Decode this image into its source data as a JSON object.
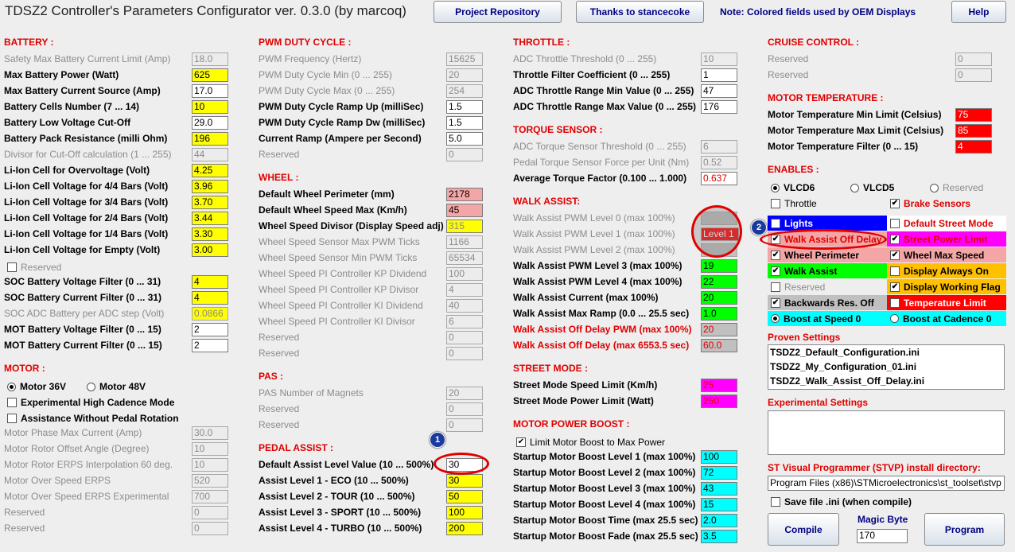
{
  "app": {
    "title": "TDSZ2 Controller's Parameters Configurator ver. 0.3.0 (by marcoq)"
  },
  "toolbar": {
    "repo": "Project Repository",
    "thanks": "Thanks to stancecoke",
    "note": "Note: Colored fields used by OEM Displays",
    "help": "Help"
  },
  "battery": {
    "title": "BATTERY :",
    "rows": [
      {
        "label": "Safety Max Battery Current Limit (Amp)",
        "value": "18.0"
      },
      {
        "label": "Max Battery Power (Watt)",
        "value": "625"
      },
      {
        "label": "Max Battery Current Source (Amp)",
        "value": "17.0"
      },
      {
        "label": "Battery Cells Number (7 ... 14)",
        "value": "10"
      },
      {
        "label": "Battery Low Voltage Cut-Off",
        "value": "29.0"
      },
      {
        "label": "Battery Pack Resistance (milli Ohm)",
        "value": "196"
      },
      {
        "label": "Divisor for Cut-Off calculation (1 ... 255)",
        "value": "44"
      },
      {
        "label": "Li-Ion Cell for Overvoltage (Volt)",
        "value": "4.25"
      },
      {
        "label": "Li-Ion Cell Voltage for 4/4 Bars (Volt)",
        "value": "3.96"
      },
      {
        "label": "Li-Ion Cell Voltage for 3/4 Bars (Volt)",
        "value": "3.70"
      },
      {
        "label": "Li-Ion Cell Voltage for 2/4 Bars (Volt)",
        "value": "3.44"
      },
      {
        "label": "Li-Ion Cell Voltage for 1/4 Bars (Volt)",
        "value": "3.30"
      },
      {
        "label": "Li-Ion Cell Voltage for Empty (Volt)",
        "value": "3.00"
      }
    ],
    "reserved": "Reserved",
    "rows2": [
      {
        "label": "SOC Battery Voltage Filter (0 ... 31)",
        "value": "4"
      },
      {
        "label": "SOC Battery Current Filter (0 ... 31)",
        "value": "4"
      },
      {
        "label": "SOC ADC Battery per ADC step (Volt)",
        "value": "0.0866"
      },
      {
        "label": "MOT Battery Voltage Filter (0 ... 15)",
        "value": "2"
      },
      {
        "label": "MOT Battery Current Filter (0 ... 15)",
        "value": "2"
      }
    ]
  },
  "motor": {
    "title": "MOTOR :",
    "v36": "Motor 36V",
    "v48": "Motor 48V",
    "high_cad": "Experimental High Cadence Mode",
    "assist_no_pedal": "Assistance Without Pedal Rotation",
    "rows": [
      {
        "label": "Motor Phase Max Current (Amp)",
        "value": "30.0"
      },
      {
        "label": "Motor Rotor Offset Angle (Degree)",
        "value": "10"
      },
      {
        "label": "Motor Rotor ERPS Interpolation 60 deg.",
        "value": "10"
      },
      {
        "label": "Motor Over Speed ERPS",
        "value": "520"
      },
      {
        "label": "Motor Over Speed ERPS Experimental",
        "value": "700"
      },
      {
        "label": "Reserved",
        "value": "0"
      },
      {
        "label": "Reserved",
        "value": "0"
      }
    ]
  },
  "pwm": {
    "title": "PWM DUTY CYCLE :",
    "rows": [
      {
        "label": "PWM Frequency (Hertz)",
        "value": "15625"
      },
      {
        "label": "PWM Duty Cycle Min (0 ... 255)",
        "value": "20"
      },
      {
        "label": "PWM Duty Cycle Max (0 ... 255)",
        "value": "254"
      },
      {
        "label": "PWM Duty Cycle Ramp Up (milliSec)",
        "value": "1.5"
      },
      {
        "label": "PWM Duty Cycle Ramp Dw (milliSec)",
        "value": "1.5"
      },
      {
        "label": "Current Ramp (Ampere per Second)",
        "value": "5.0"
      },
      {
        "label": "Reserved",
        "value": "0"
      }
    ]
  },
  "wheel": {
    "title": "WHEEL :",
    "rows": [
      {
        "label": "Default Wheel Perimeter (mm)",
        "value": "2178"
      },
      {
        "label": "Default Wheel Speed Max (Km/h)",
        "value": "45"
      },
      {
        "label": "Wheel Speed Divisor (Display Speed adj)",
        "value": "315"
      },
      {
        "label": "Wheel Speed Sensor Max PWM Ticks",
        "value": "1166"
      },
      {
        "label": "Wheel Speed Sensor Min PWM Ticks",
        "value": "65534"
      },
      {
        "label": "Wheel Speed PI Controller KP Dividend",
        "value": "100"
      },
      {
        "label": "Wheel Speed PI Controller KP Divisor",
        "value": "4"
      },
      {
        "label": "Wheel Speed PI Controller KI Dividend",
        "value": "40"
      },
      {
        "label": "Wheel Speed PI Controller KI Divisor",
        "value": "6"
      },
      {
        "label": "Reserved",
        "value": "0"
      },
      {
        "label": "Reserved",
        "value": "0"
      }
    ]
  },
  "pas": {
    "title": "PAS :",
    "rows": [
      {
        "label": "PAS Number of Magnets",
        "value": "20"
      },
      {
        "label": "Reserved",
        "value": "0"
      },
      {
        "label": "Reserved",
        "value": "0"
      }
    ]
  },
  "pedal": {
    "title": "PEDAL ASSIST :",
    "rows": [
      {
        "label": "Default Assist Level Value (10 ... 500%)",
        "value": "30"
      },
      {
        "label": "Assist Level 1 - ECO (10 ... 500%)",
        "value": "30"
      },
      {
        "label": "Assist Level 2 - TOUR (10 ... 500%)",
        "value": "50"
      },
      {
        "label": "Assist Level 3 - SPORT (10 ... 500%)",
        "value": "100"
      },
      {
        "label": "Assist Level 4 - TURBO (10 ... 500%)",
        "value": "200"
      }
    ]
  },
  "throttle": {
    "title": "THROTTLE :",
    "rows": [
      {
        "label": "ADC Throttle Threshold (0 ... 255)",
        "value": "10"
      },
      {
        "label": "Throttle Filter Coefficient (0 ... 255)",
        "value": "1"
      },
      {
        "label": "ADC Throttle Range Min Value (0 ... 255)",
        "value": "47"
      },
      {
        "label": "ADC Throttle Range Max Value (0 ... 255)",
        "value": "176"
      }
    ]
  },
  "torque": {
    "title": "TORQUE SENSOR :",
    "rows": [
      {
        "label": "ADC Torque Sensor Threshold (0 ... 255)",
        "value": "6"
      },
      {
        "label": "Pedal Torque Sensor Force per Unit (Nm)",
        "value": "0.52"
      },
      {
        "label": "Average Torque Factor (0.100 ... 1.000)",
        "value": "0.637"
      }
    ]
  },
  "walk": {
    "title": "WALK ASSIST:",
    "rows": [
      {
        "label": "Walk Assist PWM Level 0 (max 100%)",
        "value": ""
      },
      {
        "label": "Walk Assist PWM Level 1 (max 100%)",
        "value": "Level 1"
      },
      {
        "label": "Walk Assist PWM Level 2 (max 100%)",
        "value": ""
      },
      {
        "label": "Walk Assist PWM Level 3 (max 100%)",
        "value": "19"
      },
      {
        "label": "Walk Assist PWM Level 4 (max 100%)",
        "value": "22"
      },
      {
        "label": "Walk Assist Current (max 100%)",
        "value": "20"
      },
      {
        "label": "Walk Assist Max Ramp (0.0 ... 25.5 sec)",
        "value": "1.0"
      },
      {
        "label": "Walk Assist Off Delay PWM (max 100%)",
        "value": "20"
      },
      {
        "label": "Walk Assist Off Delay (max 6553.5 sec)",
        "value": "60.0"
      }
    ]
  },
  "street": {
    "title": "STREET MODE :",
    "rows": [
      {
        "label": "Street Mode Speed Limit (Km/h)",
        "value": "25"
      },
      {
        "label": "Street Mode Power Limit (Watt)",
        "value": "250"
      }
    ]
  },
  "boost": {
    "title": "MOTOR POWER BOOST :",
    "limit": "Limit Motor Boost to Max Power",
    "rows": [
      {
        "label": "Startup Motor Boost Level 1 (max 100%)",
        "value": "100"
      },
      {
        "label": "Startup Motor Boost Level 2 (max 100%)",
        "value": "72"
      },
      {
        "label": "Startup Motor Boost Level 3 (max 100%)",
        "value": "43"
      },
      {
        "label": "Startup Motor Boost Level 4 (max 100%)",
        "value": "15"
      },
      {
        "label": "Startup Motor Boost Time (max 25.5 sec)",
        "value": "2.0"
      },
      {
        "label": "Startup Motor Boost Fade (max 25.5 sec)",
        "value": "3.5"
      }
    ]
  },
  "cruise": {
    "title": "CRUISE CONTROL :",
    "rows": [
      {
        "label": "Reserved",
        "value": "0"
      },
      {
        "label": "Reserved",
        "value": "0"
      }
    ]
  },
  "temp": {
    "title": "MOTOR TEMPERATURE :",
    "rows": [
      {
        "label": "Motor Temperature Min Limit (Celsius)",
        "value": "75"
      },
      {
        "label": "Motor Temperature Max Limit (Celsius)",
        "value": "85"
      },
      {
        "label": "Motor Temperature Filter (0 ... 15)",
        "value": "4"
      }
    ]
  },
  "enables": {
    "title": "ENABLES :",
    "vlcd6": "VLCD6",
    "vlcd5": "VLCD5",
    "reserved": "Reserved",
    "throttle": "Throttle",
    "brake": "Brake Sensors",
    "grid": [
      "Lights",
      "Default Street Mode",
      "Walk Assist Off Delay",
      "Street Power Limit",
      "Wheel Perimeter",
      "Wheel Max Speed",
      "Walk Assist",
      "Display Always On",
      "Reserved",
      "Display Working Flag",
      "Backwards Res. Off",
      "Temperature Limit",
      "Boost at Speed 0",
      "Boost at Cadence 0"
    ]
  },
  "proven": {
    "title": "Proven Settings",
    "files": [
      "TSDZ2_Default_Configuration.ini",
      "TSDZ2_My_Configuration_01.ini",
      "TSDZ2_Walk_Assist_Off_Delay.ini"
    ]
  },
  "experimental": {
    "title": "Experimental Settings"
  },
  "stvp": {
    "title": "ST Visual Programmer (STVP) install directory:",
    "path": "Program Files (x86)\\STMicroelectronics\\st_toolset\\stvp"
  },
  "save": {
    "label": "Save file .ini (when compile)"
  },
  "magic": {
    "label": "Magic Byte",
    "value": "170"
  },
  "actions": {
    "compile": "Compile",
    "program": "Program"
  },
  "badges": {
    "one": "1",
    "two": "2"
  },
  "colors": {
    "yellow": "#ffff00",
    "pink": "#f4a6a6",
    "red": "#ff0000",
    "green": "#00ff00",
    "magenta": "#ff00ff",
    "cyan": "#00ffff",
    "blue": "#0000ff",
    "orange": "#ffc000",
    "gray": "#c0c0c0"
  }
}
